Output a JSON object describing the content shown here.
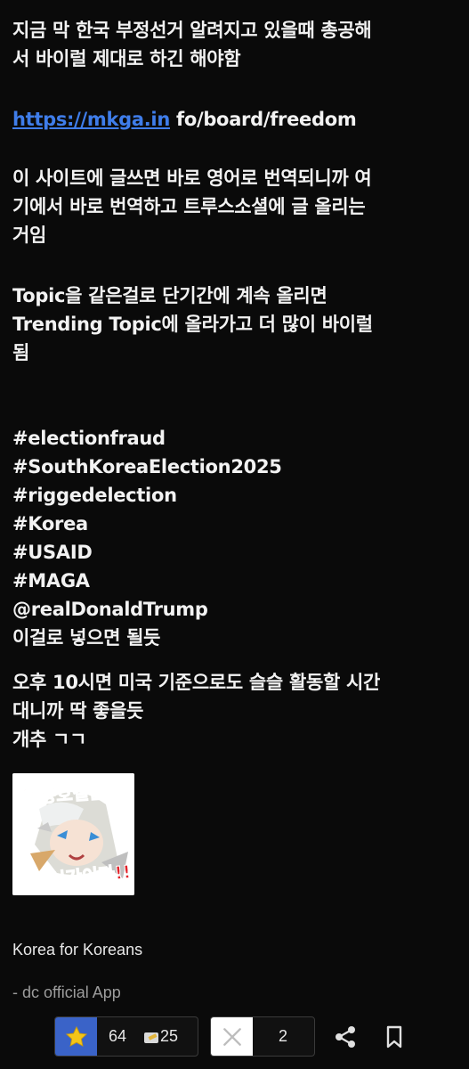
{
  "post": {
    "p1": [
      "지금 막 한국 부정선거 알려지고 있을때 총공해",
      "서 바이럴 제대로 하긴 해야함"
    ],
    "link": {
      "part1": "https://mkga.in",
      "part2": " fo/board/freedom"
    },
    "p3": [
      "이 사이트에 글쓰면 바로 영어로 번역되니까 여",
      "기에서 바로 번역하고 트루스소셜에 글 올리는",
      "거임"
    ],
    "p4": [
      "Topic을 같은걸로 단기간에 계속 올리면",
      "Trending Topic에 올라가고 더 많이 바이럴",
      "됨"
    ],
    "tags": [
      "#electionfraud",
      "#SouthKoreaElection2025",
      "#riggedelection",
      "#Korea",
      "#USAID",
      "#MAGA",
      "@realDonaldTrump",
      "이걸로 넣으면 될듯"
    ],
    "p6": [
      "오후 10시면 미국 기준으로도 슬슬 활동할 시간",
      "대니까 딱 좋을듯",
      "개추 ㄱㄱ"
    ]
  },
  "dccon": {
    "text_top": "영웅호걸들의",
    "text_bottom": "시간이다!!"
  },
  "signature": "Korea for Koreans",
  "app_label": "- dc official App",
  "actions": {
    "recommend_count": "64",
    "fix_count": "25",
    "nonrecommend_count": "2",
    "star_icon": "star-icon",
    "x_icon": "x-icon",
    "share_icon": "share-icon",
    "bookmark_icon": "bookmark-icon"
  },
  "colors": {
    "background": "#0a0a0a",
    "link": "#3f7dea",
    "recommend_button": "#3a63c8",
    "star": "#f5c518"
  }
}
